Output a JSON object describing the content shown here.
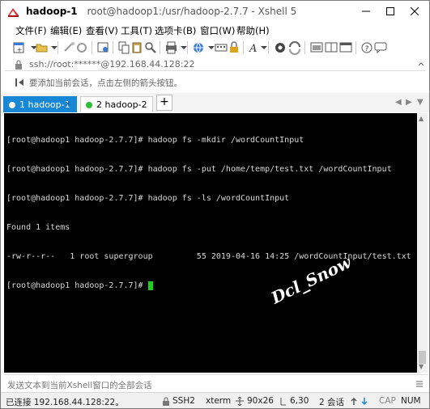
{
  "window": {
    "title_session": "hadoop-1",
    "title_path": "root@hadoop1:/usr/hadoop-2.7.7 - Xshell 5"
  },
  "menu": [
    "文件(F)",
    "编辑(E)",
    "查看(V)",
    "工具(T)",
    "选项卡(B)",
    "窗口(W)",
    "帮助(H)"
  ],
  "address": {
    "text": "ssh://root:******@192.168.44.128:22"
  },
  "hint": {
    "text": "要添加当前会话，点击左侧的箭头按钮。"
  },
  "tabs": [
    {
      "label": "1 hadoop-1",
      "active": true
    },
    {
      "label": "2 hadoop-2",
      "active": false
    }
  ],
  "tab_new_label": "+",
  "terminal": {
    "lines": [
      "[root@hadoop1 hadoop-2.7.7]# hadoop fs -mkdir /wordCountInput",
      "[root@hadoop1 hadoop-2.7.7]# hadoop fs -put /home/temp/test.txt /wordCountInput",
      "[root@hadoop1 hadoop-2.7.7]# hadoop fs -ls /wordCountInput",
      "Found 1 items",
      "-rw-r--r--   1 root supergroup         55 2019-04-16 14:25 /wordCountInput/test.txt"
    ],
    "prompt": "[root@hadoop1 hadoop-2.7.7]# ",
    "watermark": "Dcl_Snow"
  },
  "sendbar": {
    "placeholder": "发送文本到当前Xshell窗口的全部会话"
  },
  "status": {
    "connection": "已连接 192.168.44.128:22。",
    "protocol": "SSH2",
    "terminal_type": "xterm",
    "size": "90x26",
    "cursor_pos": "6,30",
    "sessions": "2 会话",
    "caps": "CAP",
    "num": "NUM"
  },
  "colors": {
    "active_tab": "#1787d6",
    "cursor": "#19d119",
    "session_dot": "#2dbf33"
  }
}
